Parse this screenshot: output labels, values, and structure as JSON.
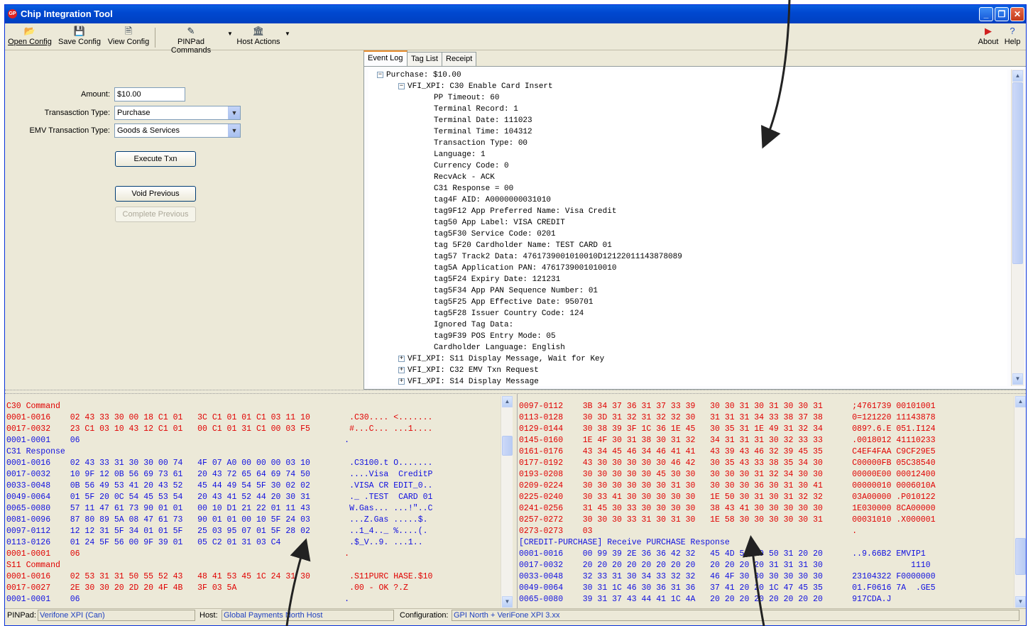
{
  "window": {
    "title": "Chip Integration Tool",
    "app_icon": "chip-app-icon"
  },
  "toolbar": {
    "open_config": "Open Config",
    "save_config": "Save Config",
    "view_config": "View Config",
    "pinpad_commands": "PINPad Commands",
    "host_actions": "Host Actions",
    "about": "About",
    "help": "Help"
  },
  "form": {
    "amount_label": "Amount:",
    "amount_value": "$10.00",
    "txn_type_label": "Transasction Type:",
    "txn_type_value": "Purchase",
    "emv_type_label": "EMV Transaction Type:",
    "emv_type_value": "Goods & Services",
    "execute_label": "Execute Txn",
    "void_label": "Void Previous",
    "complete_label": "Complete Previous"
  },
  "tabs": [
    "Event Log",
    "Tag List",
    "Receipt"
  ],
  "tree": {
    "root": "Purchase: $10.00",
    "node": "VFI_XPI: C30 Enable Card Insert",
    "children": [
      "PP Timeout: 60",
      "Terminal Record: 1",
      "Terminal Date: 111023",
      "Terminal Time: 104312",
      "Transaction Type: 00",
      "Language: 1",
      "Currency Code: 0",
      "RecvAck - ACK",
      "C31 Response = 00",
      "tag4F AID: A0000000031010",
      "tag9F12 App Preferred Name: Visa Credit",
      "tag50 App Label: VISA CREDIT",
      "tag5F30 Service Code: 0201",
      "tag 5F20 Cardholder Name: TEST CARD 01",
      "tag57 Track2 Data: 4761739001010010D12122011143878089",
      "tag5A Application PAN: 4761739001010010",
      "tag5F24 Expiry Date: 121231",
      "tag5F34 App PAN Sequence Number: 01",
      "tag5F25 App Effective Date: 950701",
      "tag5F28 Issuer Country Code: 124",
      "Ignored Tag Data:",
      "tag9F39 POS Entry Mode: 05",
      "Cardholder Language: English"
    ],
    "collapsed": [
      "VFI_XPI: S11 Display Message, Wait for Key",
      "VFI_XPI: C32 EMV Txn Request",
      "VFI_XPI: S14 Display Message"
    ]
  },
  "hex_left": [
    {
      "c": "red",
      "t": "C30 Command"
    },
    {
      "c": "red",
      "t": "0001-0016    02 43 33 30 00 18 C1 01   3C C1 01 01 C1 03 11 10        .C30.... <......."
    },
    {
      "c": "red",
      "t": "0017-0032    23 C1 03 10 43 12 C1 01   00 C1 01 31 C1 00 03 F5        #...C... ...1...."
    },
    {
      "c": "blue",
      "t": "0001-0001    06                                                      ."
    },
    {
      "c": "blue",
      "t": "C31 Response"
    },
    {
      "c": "blue",
      "t": "0001-0016    02 43 33 31 30 30 00 74   4F 07 A0 00 00 00 03 10        .C3100.t O......."
    },
    {
      "c": "blue",
      "t": "0017-0032    10 9F 12 0B 56 69 73 61   20 43 72 65 64 69 74 50        ....Visa  CreditP"
    },
    {
      "c": "blue",
      "t": "0033-0048    0B 56 49 53 41 20 43 52   45 44 49 54 5F 30 02 02        .VISA CR EDIT_0.."
    },
    {
      "c": "blue",
      "t": "0049-0064    01 5F 20 0C 54 45 53 54   20 43 41 52 44 20 30 31        ._ .TEST  CARD 01"
    },
    {
      "c": "blue",
      "t": "0065-0080    57 11 47 61 73 90 01 01   00 10 D1 21 22 01 11 43        W.Gas... ...!\"..C"
    },
    {
      "c": "blue",
      "t": "0081-0096    87 80 89 5A 08 47 61 73   90 01 01 00 10 5F 24 03        ...Z.Gas .....$."
    },
    {
      "c": "blue",
      "t": "0097-0112    12 12 31 5F 34 01 01 5F   25 03 95 07 01 5F 28 02        ..1_4.._ %....(."
    },
    {
      "c": "blue",
      "t": "0113-0126    01 24 5F 56 00 9F 39 01   05 C2 01 31 03 C4              .$_V..9. ...1.."
    },
    {
      "c": "red",
      "t": "0001-0001    06                                                      ."
    },
    {
      "c": "red",
      "t": "S11 Command"
    },
    {
      "c": "red",
      "t": "0001-0016    02 53 31 31 50 55 52 43   48 41 53 45 1C 24 31 30        .S11PURC HASE.$10"
    },
    {
      "c": "red",
      "t": "0017-0027    2E 30 30 20 2D 20 4F 4B   3F 03 5A                       .00 - OK ?.Z"
    },
    {
      "c": "blue",
      "t": "0001-0001    06                                                      ."
    }
  ],
  "hex_right": [
    {
      "c": "red",
      "t": "0097-0112    3B 34 37 36 31 37 33 39   30 30 31 30 31 30 30 31      ;4761739 00101001"
    },
    {
      "c": "red",
      "t": "0113-0128    30 3D 31 32 31 32 32 30   31 31 31 34 33 38 37 38      0=121220 11143878"
    },
    {
      "c": "red",
      "t": "0129-0144    30 38 39 3F 1C 36 1E 45   30 35 31 1E 49 31 32 34      089?.6.E 051.I124"
    },
    {
      "c": "red",
      "t": "0145-0160    1E 4F 30 31 38 30 31 32   34 31 31 31 30 32 33 33      .0018012 41110233"
    },
    {
      "c": "red",
      "t": "0161-0176    43 34 45 46 34 46 41 41   43 39 43 46 32 39 45 35      C4EF4FAA C9CF29E5"
    },
    {
      "c": "red",
      "t": "0177-0192    43 30 30 30 30 30 46 42   30 35 43 33 38 35 34 30      C00000FB 05C38540"
    },
    {
      "c": "red",
      "t": "0193-0208    30 30 30 30 30 45 30 30   30 30 30 31 32 34 30 30      00000E00 00012400"
    },
    {
      "c": "red",
      "t": "0209-0224    30 30 30 30 30 30 31 30   30 30 30 36 30 31 30 41      00000010 0006010A"
    },
    {
      "c": "red",
      "t": "0225-0240    30 33 41 30 30 30 30 30   1E 50 30 31 30 31 32 32      03A00000 .P010122"
    },
    {
      "c": "red",
      "t": "0241-0256    31 45 30 33 30 30 30 30   38 43 41 30 30 30 30 30      1E030000 8CA00000"
    },
    {
      "c": "red",
      "t": "0257-0272    30 30 30 33 31 30 31 30   1E 58 30 30 30 30 30 31      00031010 .X000001"
    },
    {
      "c": "red",
      "t": "0273-0273    03                                                     ."
    },
    {
      "c": "blue",
      "t": "[CREDIT-PURCHASE] Receive PURCHASE Response"
    },
    {
      "c": "blue",
      "t": "0001-0016    00 99 39 2E 36 36 42 32   45 4D 56 49 50 31 20 20      ..9.66B2 EMVIP1"
    },
    {
      "c": "blue",
      "t": "0017-0032    20 20 20 20 20 20 20 20   20 20 20 20 31 31 31 30                  1110"
    },
    {
      "c": "blue",
      "t": "0033-0048    32 33 31 30 34 33 32 32   46 4F 30 30 30 30 30 30      23104322 F0000000"
    },
    {
      "c": "blue",
      "t": "0049-0064    30 31 1C 46 30 36 31 36   37 41 20 20 1C 47 45 35      01.F0616 7A  .GE5"
    },
    {
      "c": "blue",
      "t": "0065-0080    39 31 37 43 44 41 1C 4A   20 20 20 20 20 20 20 20      917CDA.J"
    }
  ],
  "status": {
    "pinpad_label": "PINPad:",
    "pinpad_value": "Verifone XPI (Can)",
    "host_label": "Host:",
    "host_value": "Global Payments North Host",
    "config_label": "Configuration:",
    "config_value": "GPI North + VeriFone XPI 3.xx"
  }
}
